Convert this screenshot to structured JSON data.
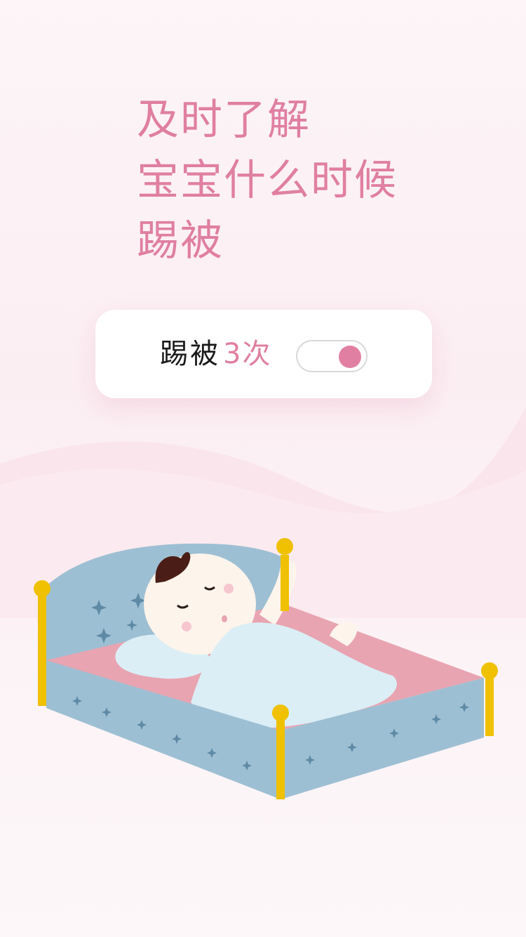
{
  "headline": {
    "lines": [
      "及时了解",
      "宝宝什么时候",
      "踢被"
    ]
  },
  "card": {
    "label": "踢被",
    "count": "3次",
    "toggle_on": true
  },
  "colors": {
    "accent": "#e07fa1",
    "bed_blue": "#9dbfd3",
    "bed_pink": "#e8a4b1",
    "post_gold": "#efc100",
    "blanket": "#dbeef5",
    "baby_skin": "#fdf4ec",
    "baby_hair": "#4a1e16"
  },
  "illustration": {
    "icon": "sleeping-baby-in-bed-illustration"
  }
}
